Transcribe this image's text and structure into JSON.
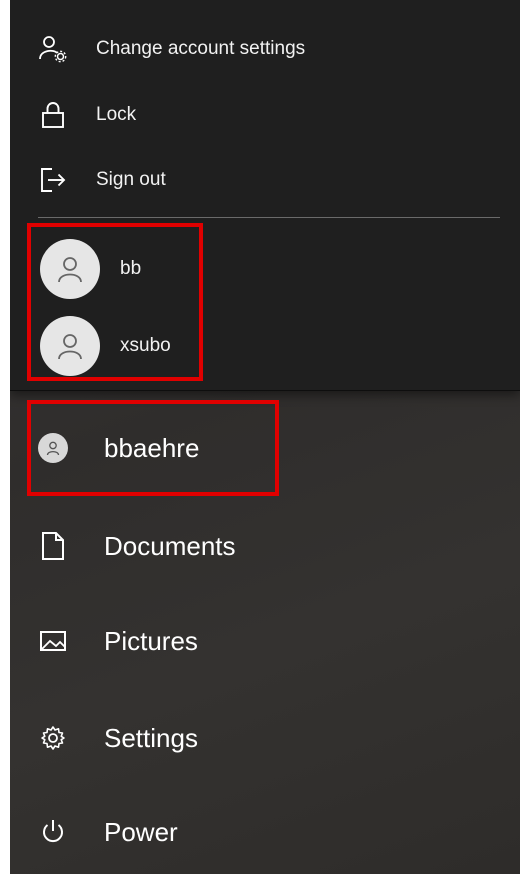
{
  "flyout": {
    "items": [
      {
        "label": "Change account settings",
        "icon": "account-settings-icon"
      },
      {
        "label": "Lock",
        "icon": "lock-icon"
      },
      {
        "label": "Sign out",
        "icon": "sign-out-icon"
      }
    ],
    "accounts": [
      {
        "name": "bb",
        "icon": "user-icon"
      },
      {
        "name": "xsubo",
        "icon": "user-icon"
      }
    ]
  },
  "rail": {
    "user": {
      "name": "bbaehre",
      "icon": "user-icon"
    },
    "items": [
      {
        "label": "Documents",
        "icon": "document-icon"
      },
      {
        "label": "Pictures",
        "icon": "pictures-icon"
      },
      {
        "label": "Settings",
        "icon": "gear-icon"
      },
      {
        "label": "Power",
        "icon": "power-icon"
      }
    ]
  },
  "colors": {
    "highlight": "#e00000",
    "flyout_bg": "#1f1f1f",
    "rail_bg": "#343230"
  }
}
